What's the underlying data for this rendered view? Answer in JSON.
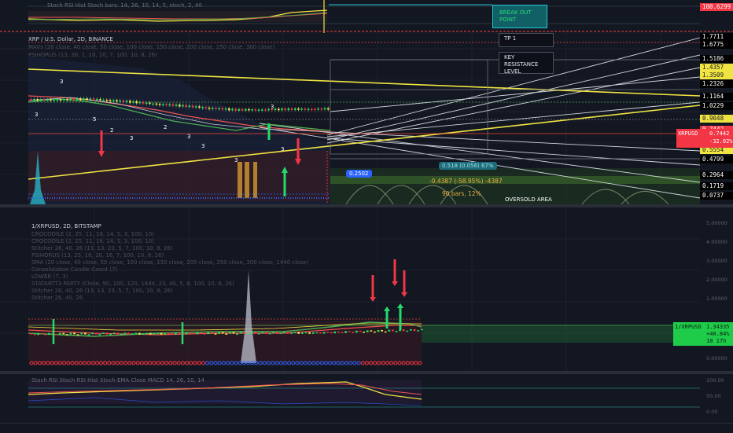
{
  "colors": {
    "bg": "#131722",
    "grid": "#1e222d",
    "up": "#26a69a",
    "down": "#ef5350",
    "yellow": "#f0e442",
    "green": "#4caf50",
    "red": "#f44336",
    "cyan": "#26c6da",
    "blue": "#2962ff"
  },
  "top_indicator": {
    "legend": "Stoch RSI  Hist  Stoch  bars: 14, 26, 10, 14, 5, stoch, 2, 40",
    "price_tag": "100.6299",
    "break_out_label": "BREAK OUT POINT"
  },
  "main": {
    "symbol_line": "XRP / U.S. Dollar, 2D, BINANCE",
    "indicator_lines": [
      "MAVs (20 close, 40 close, 50 close, 100 close, 150 close, 200 close, 250 close, 300 close)",
      "PSIHORUS (13, 26, 1, 10, 10, 7, 100, 10, 8, 26)"
    ],
    "callouts": {
      "tp": "TP 1",
      "key_resistance": "KEY RESISTANCE LEVEL",
      "oversold": "OVERSOLD AREA"
    },
    "boxes": {
      "blue_value": "0.2502",
      "teal_label": "0.518 (0.056) 67%",
      "measure_line1": "-0.4387 (-58.95%) -4387",
      "measure_line2": "90 bars, 12%"
    },
    "price_tags": [
      {
        "value": "1.7711",
        "kind": "plain"
      },
      {
        "value": "1.6775",
        "kind": "plain"
      },
      {
        "value": "1.5186",
        "kind": "plain"
      },
      {
        "value": "1.4357",
        "kind": "yellow"
      },
      {
        "value": "1.3509",
        "kind": "yellow"
      },
      {
        "value": "1.2326",
        "kind": "plain"
      },
      {
        "value": "1.1164",
        "kind": "plain"
      },
      {
        "value": "1.0229",
        "kind": "plain"
      },
      {
        "value": "0.9048",
        "kind": "yellow"
      },
      {
        "value": "0.7442",
        "kind": "red"
      },
      {
        "value": "0.5554",
        "kind": "yellow"
      },
      {
        "value": "0.4799",
        "kind": "plain"
      },
      {
        "value": "0.2964",
        "kind": "plain"
      },
      {
        "value": "0.1719",
        "kind": "plain"
      },
      {
        "value": "0.0737",
        "kind": "plain"
      }
    ],
    "xrpusd_tag": {
      "name": "XRPUSD",
      "price": "0.7442",
      "change": "-32.02%"
    },
    "candle_count_labels": [
      "3",
      "2",
      "3",
      "3",
      "5",
      "2",
      "3",
      "3",
      "3",
      "3",
      "3"
    ]
  },
  "second": {
    "symbol_line": "1/XRPUSD, 2D, BITSTAMP",
    "indicator_lines": [
      "CROCODILE (2, 25, 11, 16, 14, 5, 3, 100, 10)",
      "CROCODILE (2, 25, 11, 16, 14, 5, 3, 100, 10)",
      "Stitcher 26, 40, 26 (13, 13, 23, 5, 7, 100, 10, 8, 26)",
      "PSIHORUS (13, 25, 16, 10, 16, 7, 100, 10, 8, 26)",
      "SMA (20 close, 40 close, 50 close, 100 close, 150 close, 200 close, 250 close, 300 close, 1440 close)",
      "Consolidation Candle Count (7)",
      "LOWER (7, 3)",
      "STATARTT3 PARTY (Close, 90, 100, 120, 1444, 23, 40, 5, 8, 100, 10, 8, 26)",
      "Stitcher 26, 40, 26 (13, 13, 23, 5, 7, 100, 10, 8, 26)",
      "Stitcher 26, 40, 26"
    ],
    "tag": {
      "name": "1/XRPUSD",
      "value": "1.34335",
      "change": "+40.84%",
      "time": "10 17h"
    },
    "right_axis": [
      "5.00000",
      "4.00000",
      "3.00000",
      "2.00000",
      "1.00000",
      "0.00000"
    ]
  },
  "bottom_indicator": {
    "legend": "Stoch RSI  Stoch  RSI  Hist  Stoch  EMA  Close  MACD  14, 26, 10, 14",
    "right_axis": [
      "100.00",
      "50.00",
      "0.00"
    ]
  }
}
